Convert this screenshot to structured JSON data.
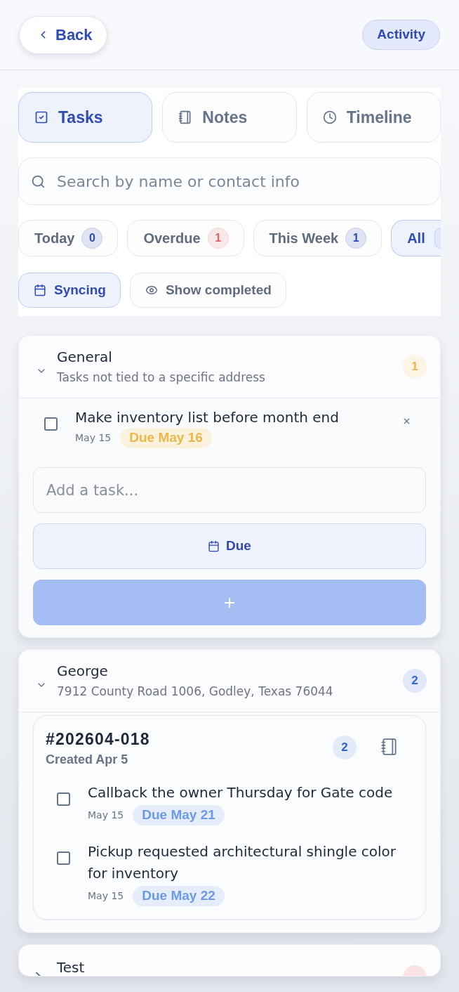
{
  "header": {
    "back": "Back",
    "activity": "Activity"
  },
  "tabs": [
    {
      "label": "Tasks",
      "selected": true
    },
    {
      "label": "Notes",
      "selected": false
    },
    {
      "label": "Timeline",
      "selected": false
    }
  ],
  "search": {
    "placeholder": "Search by name or contact info"
  },
  "filters": [
    {
      "label": "Today",
      "count": "0",
      "color": "#2f4bb6",
      "selected": false
    },
    {
      "label": "Overdue",
      "count": "1",
      "color": "#e06666",
      "selected": false
    },
    {
      "label": "This Week",
      "count": "1",
      "color": "#2f4bb6",
      "selected": false
    },
    {
      "label": "All",
      "color": "#e2e8fb",
      "selected": true
    }
  ],
  "toggles": [
    {
      "label": "Syncing",
      "on": true
    },
    {
      "label": "Show completed",
      "on": false
    }
  ],
  "sections": [
    {
      "title": "General",
      "subtitle": "Tasks not tied to a specific address",
      "count": "1",
      "color": "#e8b54a",
      "expanded": true,
      "tasks": [
        {
          "text": "Make inventory list before month end",
          "created": "May 15",
          "due": "Due May 16",
          "color": "#ebb748",
          "checked": false,
          "removable": true
        }
      ],
      "composer": {
        "placeholder": "Add a task...",
        "due_label": "Due",
        "add_disabled": true
      }
    },
    {
      "title": "George",
      "subtitle": "7912 County Road 1006, Godley, Texas 76044",
      "count": "2",
      "color": "#3164d8",
      "expanded": true,
      "jobs": [
        {
          "number": "#202604-018",
          "created": "Created Apr 5",
          "count": "2",
          "tasks": [
            {
              "text": "Callback the owner Thursday for Gate code",
              "created": "May 15",
              "due": "Due May 21",
              "color": "#6d9ae6",
              "checked": false,
              "removable": false
            },
            {
              "text": "Pickup requested architectural shingle color for inventory",
              "created": "May 15",
              "due": "Due May 22",
              "color": "#6d9ae6",
              "checked": false,
              "removable": false
            }
          ]
        }
      ]
    },
    {
      "title": "Test",
      "color": "#fbe3e3",
      "expanded": false
    }
  ]
}
